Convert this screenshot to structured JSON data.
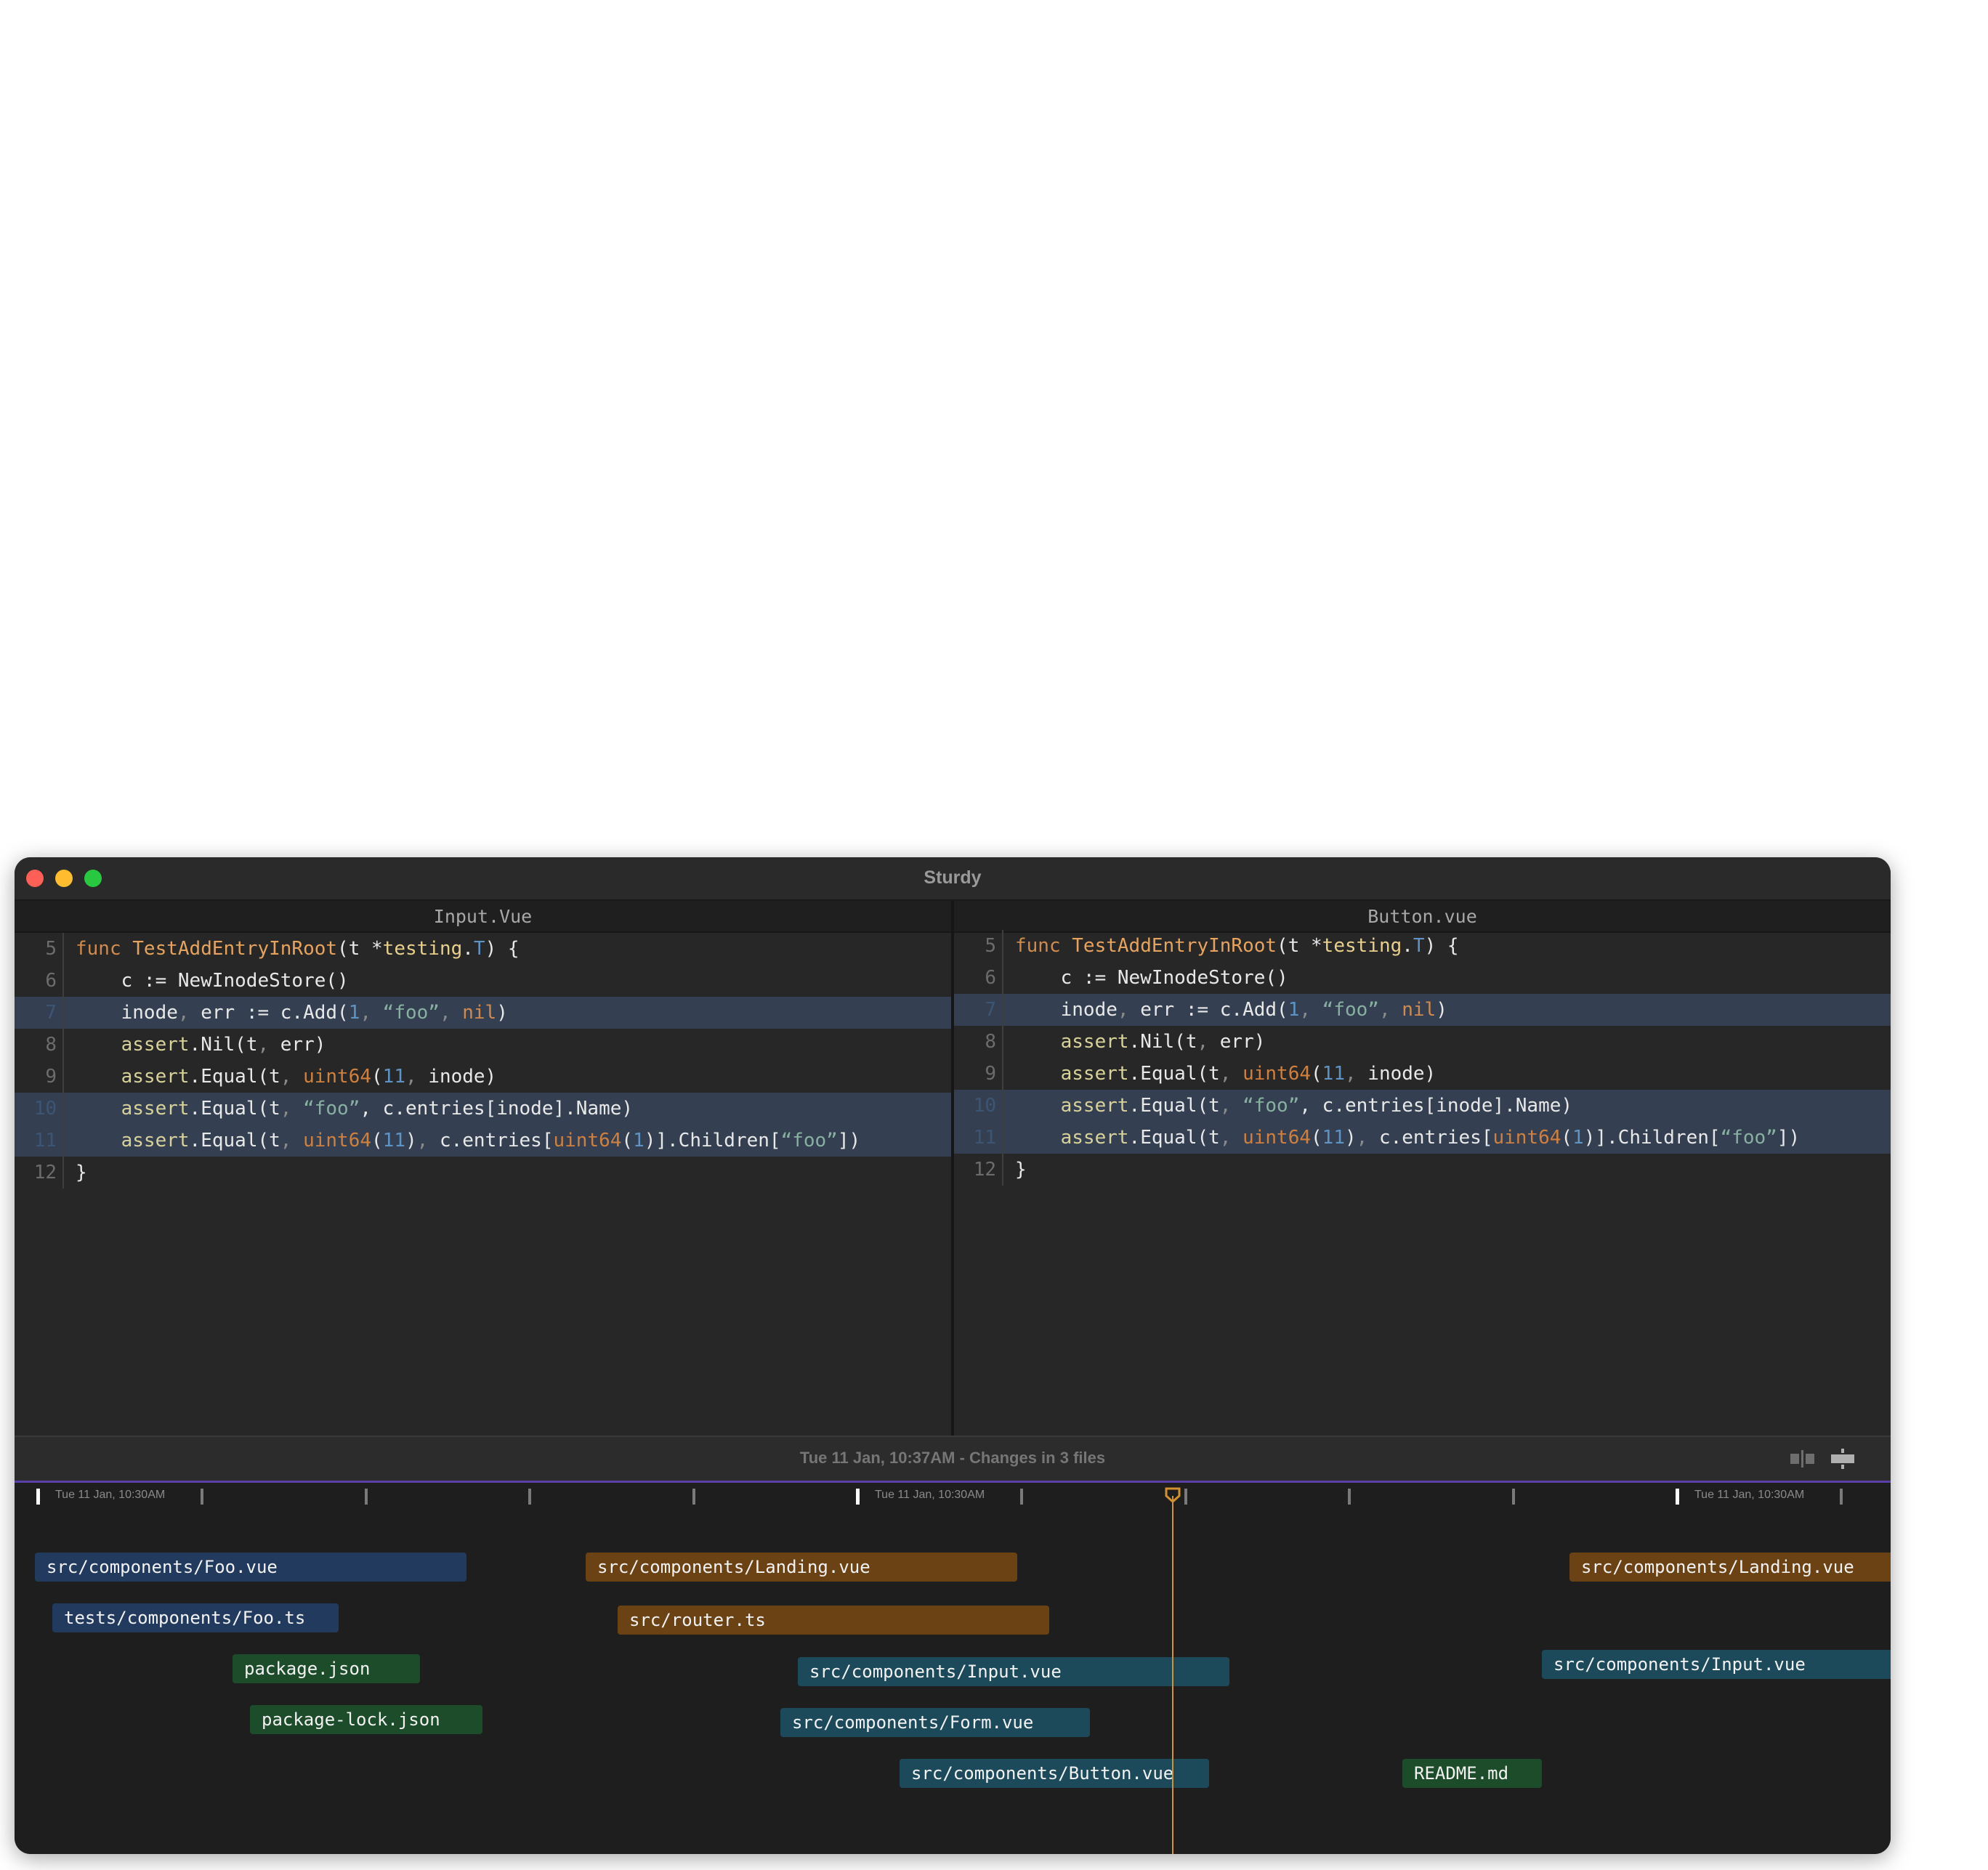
{
  "window": {
    "title": "Sturdy"
  },
  "left_pane": {
    "filename": "Input.Vue",
    "lines": [
      {
        "n": "5",
        "hl": false
      },
      {
        "n": "6",
        "hl": false
      },
      {
        "n": "7",
        "hl": true
      },
      {
        "n": "8",
        "hl": false
      },
      {
        "n": "9",
        "hl": false
      },
      {
        "n": "10",
        "hl": true
      },
      {
        "n": "11",
        "hl": true
      },
      {
        "n": "12",
        "hl": false
      }
    ]
  },
  "right_pane": {
    "filename": "Button.vue",
    "lines": [
      {
        "n": "5",
        "hl": false
      },
      {
        "n": "6",
        "hl": false
      },
      {
        "n": "7",
        "hl": true
      },
      {
        "n": "8",
        "hl": false
      },
      {
        "n": "9",
        "hl": false
      },
      {
        "n": "10",
        "hl": true
      },
      {
        "n": "11",
        "hl": true
      },
      {
        "n": "12",
        "hl": false
      }
    ]
  },
  "code": {
    "line5": {
      "func": "func",
      "name": "TestAddEntryInRoot",
      "open": "(t *",
      "pkg": "testing",
      "dot": ".",
      "type": "T",
      "close": ") {"
    },
    "line6": {
      "text": "    c := NewInodeStore()"
    },
    "line7": {
      "a": "    inode",
      "comma": ",",
      "b": " err := c.Add(",
      "num": "1",
      "c2": ",",
      "str": " “foo”",
      "c3": ",",
      "nil": " nil",
      "end": ")"
    },
    "line8": {
      "assert": "    assert",
      "rest": ".Nil(t",
      "c": ",",
      "end": " err)"
    },
    "line9": {
      "assert": "    assert",
      "rest": ".Equal(t",
      "c": ",",
      "u": " uint64",
      "p": "(",
      "num": "11",
      "c2": ",",
      "end": " inode)"
    },
    "line10": {
      "assert": "    assert",
      "rest": ".Equal(t",
      "c": ",",
      "str": " “foo”",
      "end": ", c.entries[inode].Name)"
    },
    "line11": {
      "assert": "    assert",
      "rest": ".Equal(t",
      "c": ",",
      "u": " uint64",
      "p": "(",
      "num": "11",
      "p2": ")",
      "c2": ",",
      "mid": " c.entries[",
      "u2": "uint64",
      "p3": "(",
      "num2": "1",
      "mid2": ")].Children[",
      "str": "“foo”",
      "end": "])"
    },
    "line12": {
      "text": "}"
    }
  },
  "status": {
    "text": "Tue 11 Jan, 10:37AM - Changes in 3 files"
  },
  "timeline": {
    "tick_labels": [
      "Tue 11 Jan, 10:30AM",
      "Tue 11 Jan, 10:30AM",
      "Tue 11 Jan, 10:30AM"
    ],
    "changes": [
      {
        "label": "src/components/Foo.vue"
      },
      {
        "label": "tests/components/Foo.ts"
      },
      {
        "label": "package.json"
      },
      {
        "label": "package-lock.json"
      },
      {
        "label": "src/components/Landing.vue"
      },
      {
        "label": "src/router.ts"
      },
      {
        "label": "src/components/Input.vue"
      },
      {
        "label": "src/components/Form.vue"
      },
      {
        "label": "src/components/Button.vue"
      },
      {
        "label": "README.md"
      },
      {
        "label": "src/components/Landing.vue"
      },
      {
        "label": "src/components/Input.vue"
      }
    ]
  },
  "colors": {
    "accent_purple": "#5b3fa8",
    "playhead": "#d4922e",
    "highlight_line": "#344052"
  }
}
